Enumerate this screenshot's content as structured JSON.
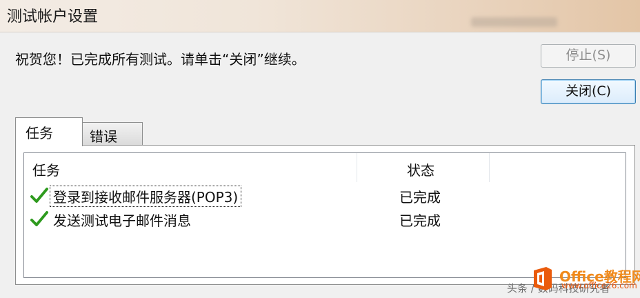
{
  "window": {
    "title": "测试帐户设置"
  },
  "message": "祝贺您！已完成所有测试。请单击“关闭”继续。",
  "buttons": {
    "stop_label": "停止(S)",
    "close_label": "关闭(C)"
  },
  "tabs": [
    {
      "label": "任务",
      "selected": true
    },
    {
      "label": "错误",
      "selected": false
    }
  ],
  "list": {
    "columns": [
      "任务",
      "状态"
    ],
    "rows": [
      {
        "task": "登录到接收邮件服务器(POP3)",
        "status": "已完成",
        "icon": "checkmark-icon"
      },
      {
        "task": "发送测试电子邮件消息",
        "status": "已完成",
        "icon": "checkmark-icon"
      }
    ]
  },
  "watermark": {
    "credit": "头条 / 数码科技研究者",
    "brand": "Office教程网",
    "url": "www.office26.com"
  },
  "colors": {
    "check_green": "#2e9a1e",
    "close_button_border": "#3c7fb1",
    "brand_orange": "#f08a1c"
  }
}
